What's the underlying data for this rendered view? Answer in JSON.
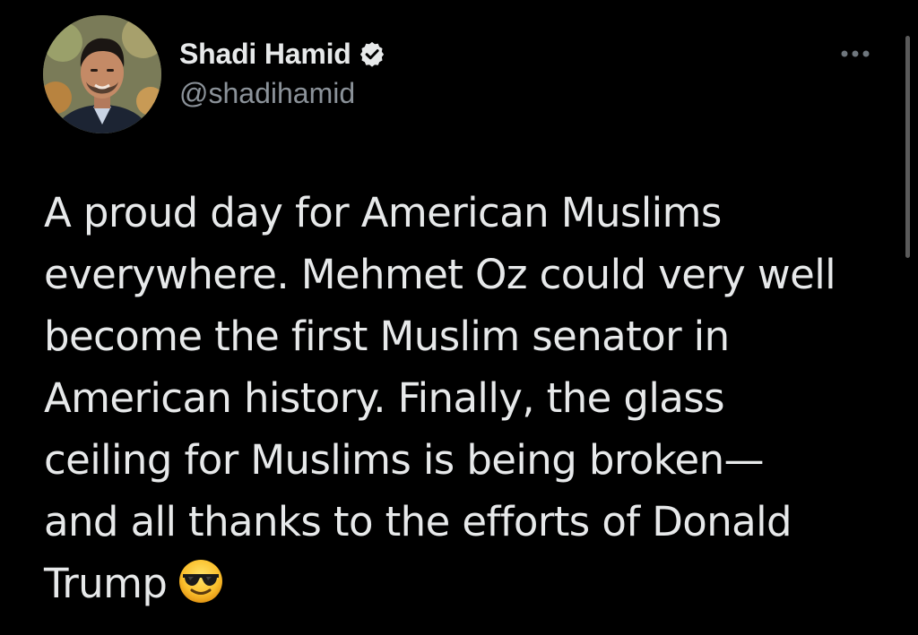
{
  "author": {
    "display_name": "Shadi Hamid",
    "handle": "@shadihamid",
    "verified": true,
    "avatar_icon": "profile-photo"
  },
  "tweet": {
    "text": "A proud day for American Muslims\neverywhere. Mehmet Oz could very well\nbecome the first Muslim senator in\nAmerican history. Finally, the glass\nceiling for Muslims is being broken—\nand all thanks to the efforts of Donald\nTrump",
    "emoji": "smiling-face-with-sunglasses"
  },
  "icons": {
    "more": "more-horizontal-icon",
    "verified": "verified-badge-icon"
  },
  "colors": {
    "background": "#000000",
    "text_primary": "#e7e9ea",
    "text_secondary": "#8b9299"
  }
}
